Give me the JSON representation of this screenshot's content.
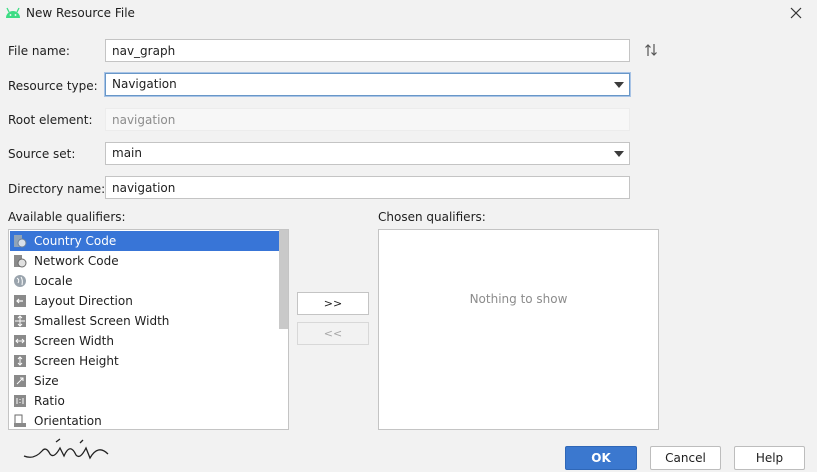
{
  "window": {
    "title": "New Resource File",
    "app_icon": "android-icon",
    "close_icon": "close-icon"
  },
  "form": {
    "file_name": {
      "label": "File name:",
      "value": "nav_graph"
    },
    "resource_type": {
      "label": "Resource type:",
      "value": "Navigation"
    },
    "root_element": {
      "label": "Root element:",
      "value": "navigation"
    },
    "source_set": {
      "label": "Source set:",
      "value": "main"
    },
    "directory_name": {
      "label": "Directory name:",
      "value": "navigation"
    }
  },
  "available_qualifiers": {
    "label": "Available qualifiers:",
    "items": [
      {
        "label": "Country Code",
        "icon": "country-code-icon",
        "selected": true
      },
      {
        "label": "Network Code",
        "icon": "network-code-icon",
        "selected": false
      },
      {
        "label": "Locale",
        "icon": "globe-icon",
        "selected": false
      },
      {
        "label": "Layout Direction",
        "icon": "layout-direction-icon",
        "selected": false
      },
      {
        "label": "Smallest Screen Width",
        "icon": "smallest-screen-width-icon",
        "selected": false
      },
      {
        "label": "Screen Width",
        "icon": "screen-width-icon",
        "selected": false
      },
      {
        "label": "Screen Height",
        "icon": "screen-height-icon",
        "selected": false
      },
      {
        "label": "Size",
        "icon": "size-icon",
        "selected": false
      },
      {
        "label": "Ratio",
        "icon": "ratio-icon",
        "selected": false
      },
      {
        "label": "Orientation",
        "icon": "orientation-icon",
        "selected": false
      }
    ]
  },
  "transfer": {
    "add_label": ">>",
    "remove_label": "<<"
  },
  "chosen_qualifiers": {
    "label": "Chosen qualifiers:",
    "empty_text": "Nothing to show"
  },
  "buttons": {
    "ok": "OK",
    "cancel": "Cancel",
    "help": "Help"
  },
  "colors": {
    "selection": "#3875d7",
    "primary_button": "#3b78cf",
    "android_green": "#3ddc84"
  }
}
